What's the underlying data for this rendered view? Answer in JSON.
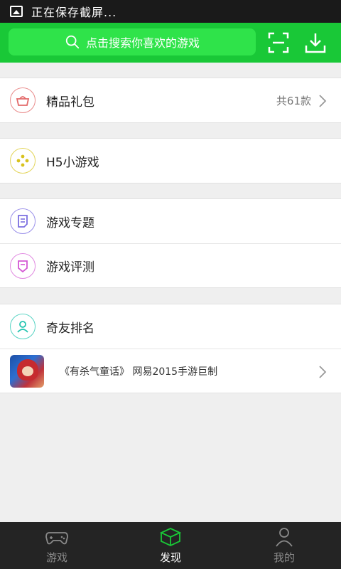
{
  "status_bar": {
    "text": "正在保存截屏..."
  },
  "header": {
    "search_placeholder": "点击搜索你喜欢的游戏",
    "accent": "#19c837",
    "icons": [
      "search-icon",
      "scan-icon",
      "download-icon"
    ]
  },
  "menu": {
    "gift": {
      "label": "精品礼包",
      "count": "共61款",
      "icon": "gift-basket-icon",
      "color": "#e36a6a"
    },
    "h5": {
      "label": "H5小游戏",
      "icon": "gamepad-dots-icon",
      "color": "#d8c21e"
    },
    "topics": {
      "label": "游戏专题",
      "icon": "document-icon",
      "color": "#7b6fe0"
    },
    "review": {
      "label": "游戏评测",
      "icon": "review-badge-icon",
      "color": "#d457d4"
    },
    "ranking": {
      "label": "奇友排名",
      "icon": "user-icon",
      "color": "#22c4b0"
    }
  },
  "promo": {
    "text": "《有杀气童话》 网易2015手游巨制",
    "thumb": "game-thumbnail"
  },
  "tabbar": {
    "tabs": [
      {
        "label": "游戏",
        "icon": "gamepad-icon",
        "active": false
      },
      {
        "label": "发现",
        "icon": "cube-discover-icon",
        "active": true
      },
      {
        "label": "我的",
        "icon": "person-icon",
        "active": false
      }
    ]
  }
}
